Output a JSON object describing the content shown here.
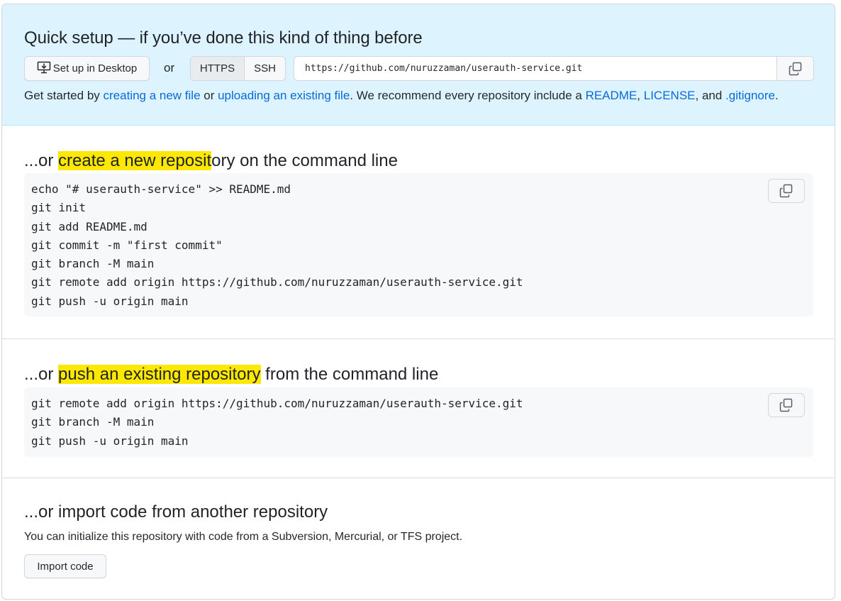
{
  "quick_setup": {
    "title": "Quick setup — if you’ve done this kind of thing before",
    "desktop_button": "Set up in Desktop",
    "or_label": "or",
    "protocols": [
      "HTTPS",
      "SSH"
    ],
    "selected_protocol": "HTTPS",
    "clone_url": "https://github.com/nuruzzaman/userauth-service.git",
    "get_started": {
      "prefix": "Get started by ",
      "link_new_file": "creating a new file",
      "mid1": " or ",
      "link_upload": "uploading an existing file",
      "mid2": ". We recommend every repository include a ",
      "link_readme": "README",
      "comma": ", ",
      "link_license": "LICENSE",
      "mid3": ", and ",
      "link_gitignore": ".gitignore",
      "suffix": "."
    }
  },
  "create_section": {
    "title_prefix": "...or ",
    "title_highlight": "create a new reposit",
    "title_suffix": "ory on the command line",
    "code_lines": [
      "echo \"# userauth-service\" >> README.md",
      "git init",
      "git add README.md",
      "git commit -m \"first commit\"",
      "git branch -M main",
      "git remote add origin https://github.com/nuruzzaman/userauth-service.git",
      "git push -u origin main"
    ]
  },
  "push_section": {
    "title_prefix": "...or ",
    "title_highlight": "push an existing repository",
    "title_suffix": " from the command line",
    "code_lines": [
      "git remote add origin https://github.com/nuruzzaman/userauth-service.git",
      "git branch -M main",
      "git push -u origin main"
    ]
  },
  "import_section": {
    "title": "...or import code from another repository",
    "description": "You can initialize this repository with code from a Subversion, Mercurial, or TFS project.",
    "button": "Import code"
  },
  "icons": {
    "desktop": "desktop-download-icon",
    "copy": "copy-icon"
  },
  "colors": {
    "quick_setup_bg": "#ddf4ff",
    "link": "#0969da",
    "highlight": "#ffe800",
    "code_bg": "#f6f8fa"
  }
}
